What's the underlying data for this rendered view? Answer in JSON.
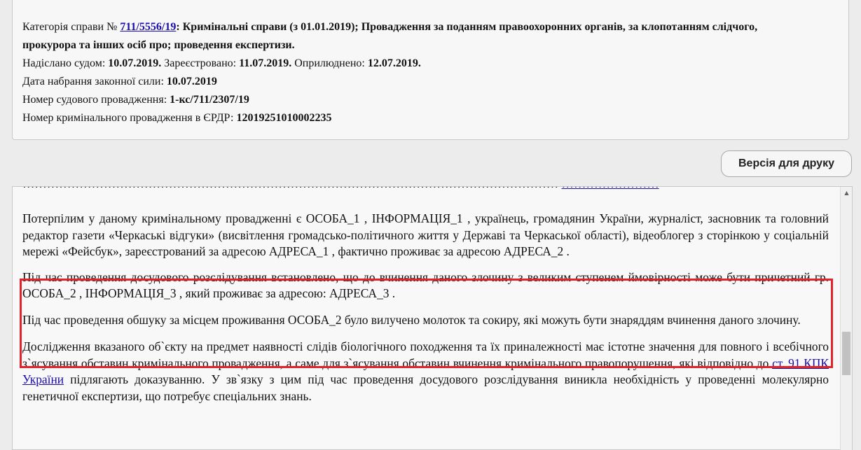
{
  "meta": {
    "category_label": "Категорія справи №",
    "case_number": "711/5556/19",
    "category_text": ": Кримінальні справи (з 01.01.2019); Провадження за поданням правоохоронних органів, за клопотанням слідчого,",
    "category_text_2": "прокурора та інших осіб про; проведення експертизи.",
    "sent_label": "Надіслано судом:",
    "sent_date": "10.07.2019.",
    "registered_label": "Зареєстровано:",
    "registered_date": "11.07.2019.",
    "published_label": "Оприлюднено:",
    "published_date": "12.07.2019.",
    "effective_label": "Дата набрання законної сили:",
    "effective_date": "10.07.2019",
    "court_proc_label": "Номер судового провадження:",
    "court_proc_number": "1-кс/711/2307/19",
    "criminal_proc_label": "Номер кримінального провадження в ЄРДР:",
    "criminal_proc_number": "12019251010002235"
  },
  "toolbar": {
    "print_label": "Версія для друку"
  },
  "document": {
    "p_top_text": "……………………………………………………………………………………………………………………",
    "p_top_link": "……………………",
    "p1": "Потерпілим у даному кримінальному провадженні є ОСОБА_1 ,  ІНФОРМАЦІЯ_1 , українець, громадянин України, журналіст, засновник та головний редактор газети «Черкаські відгуки» (висвітлення громадсько-політичного життя у Державі та Черкаської області), відеоблогер з сторінкою у соціальній мережі «Фейсбук», зареєстрований за адресою АДРЕСА_1 , фактично проживає за адресою АДРЕСА_2 .",
    "p2": "Під час проведення досудового розслідування встановлено, що до вчинення даного злочину з великим ступенем ймовірності може бути причетний гр. ОСОБА_2 , ІНФОРМАЦІЯ_3 , який проживає за адресою: АДРЕСА_3 .",
    "p3": "Під час проведення обшуку за місцем проживання ОСОБА_2 було вилучено молоток та сокиру, які можуть бути знаряддям вчинення даного злочину.",
    "p4_a": "Дослідження вказаного об`єкту на предмет наявності слідів біологічного походження та їх приналежності має істотне значення для повного і всебічного з`ясування обставин кримінального провадження, а саме для з`ясування обставин вчинення кримінального правопорушення, які відповідно до ",
    "p4_link": "ст. 91 КПК України",
    "p4_b": " підлягають доказуванню. У зв`язку з цим під час проведення досудового розслідування виникла необхідність у проведенні молекулярно генетичної експертизи, що потребує спеціальних знань."
  },
  "scrollbar": {
    "up_icon": "triangle-up",
    "down_icon": "triangle-down"
  },
  "colors": {
    "highlight_border": "#e2232b",
    "link": "#1a0dab"
  }
}
